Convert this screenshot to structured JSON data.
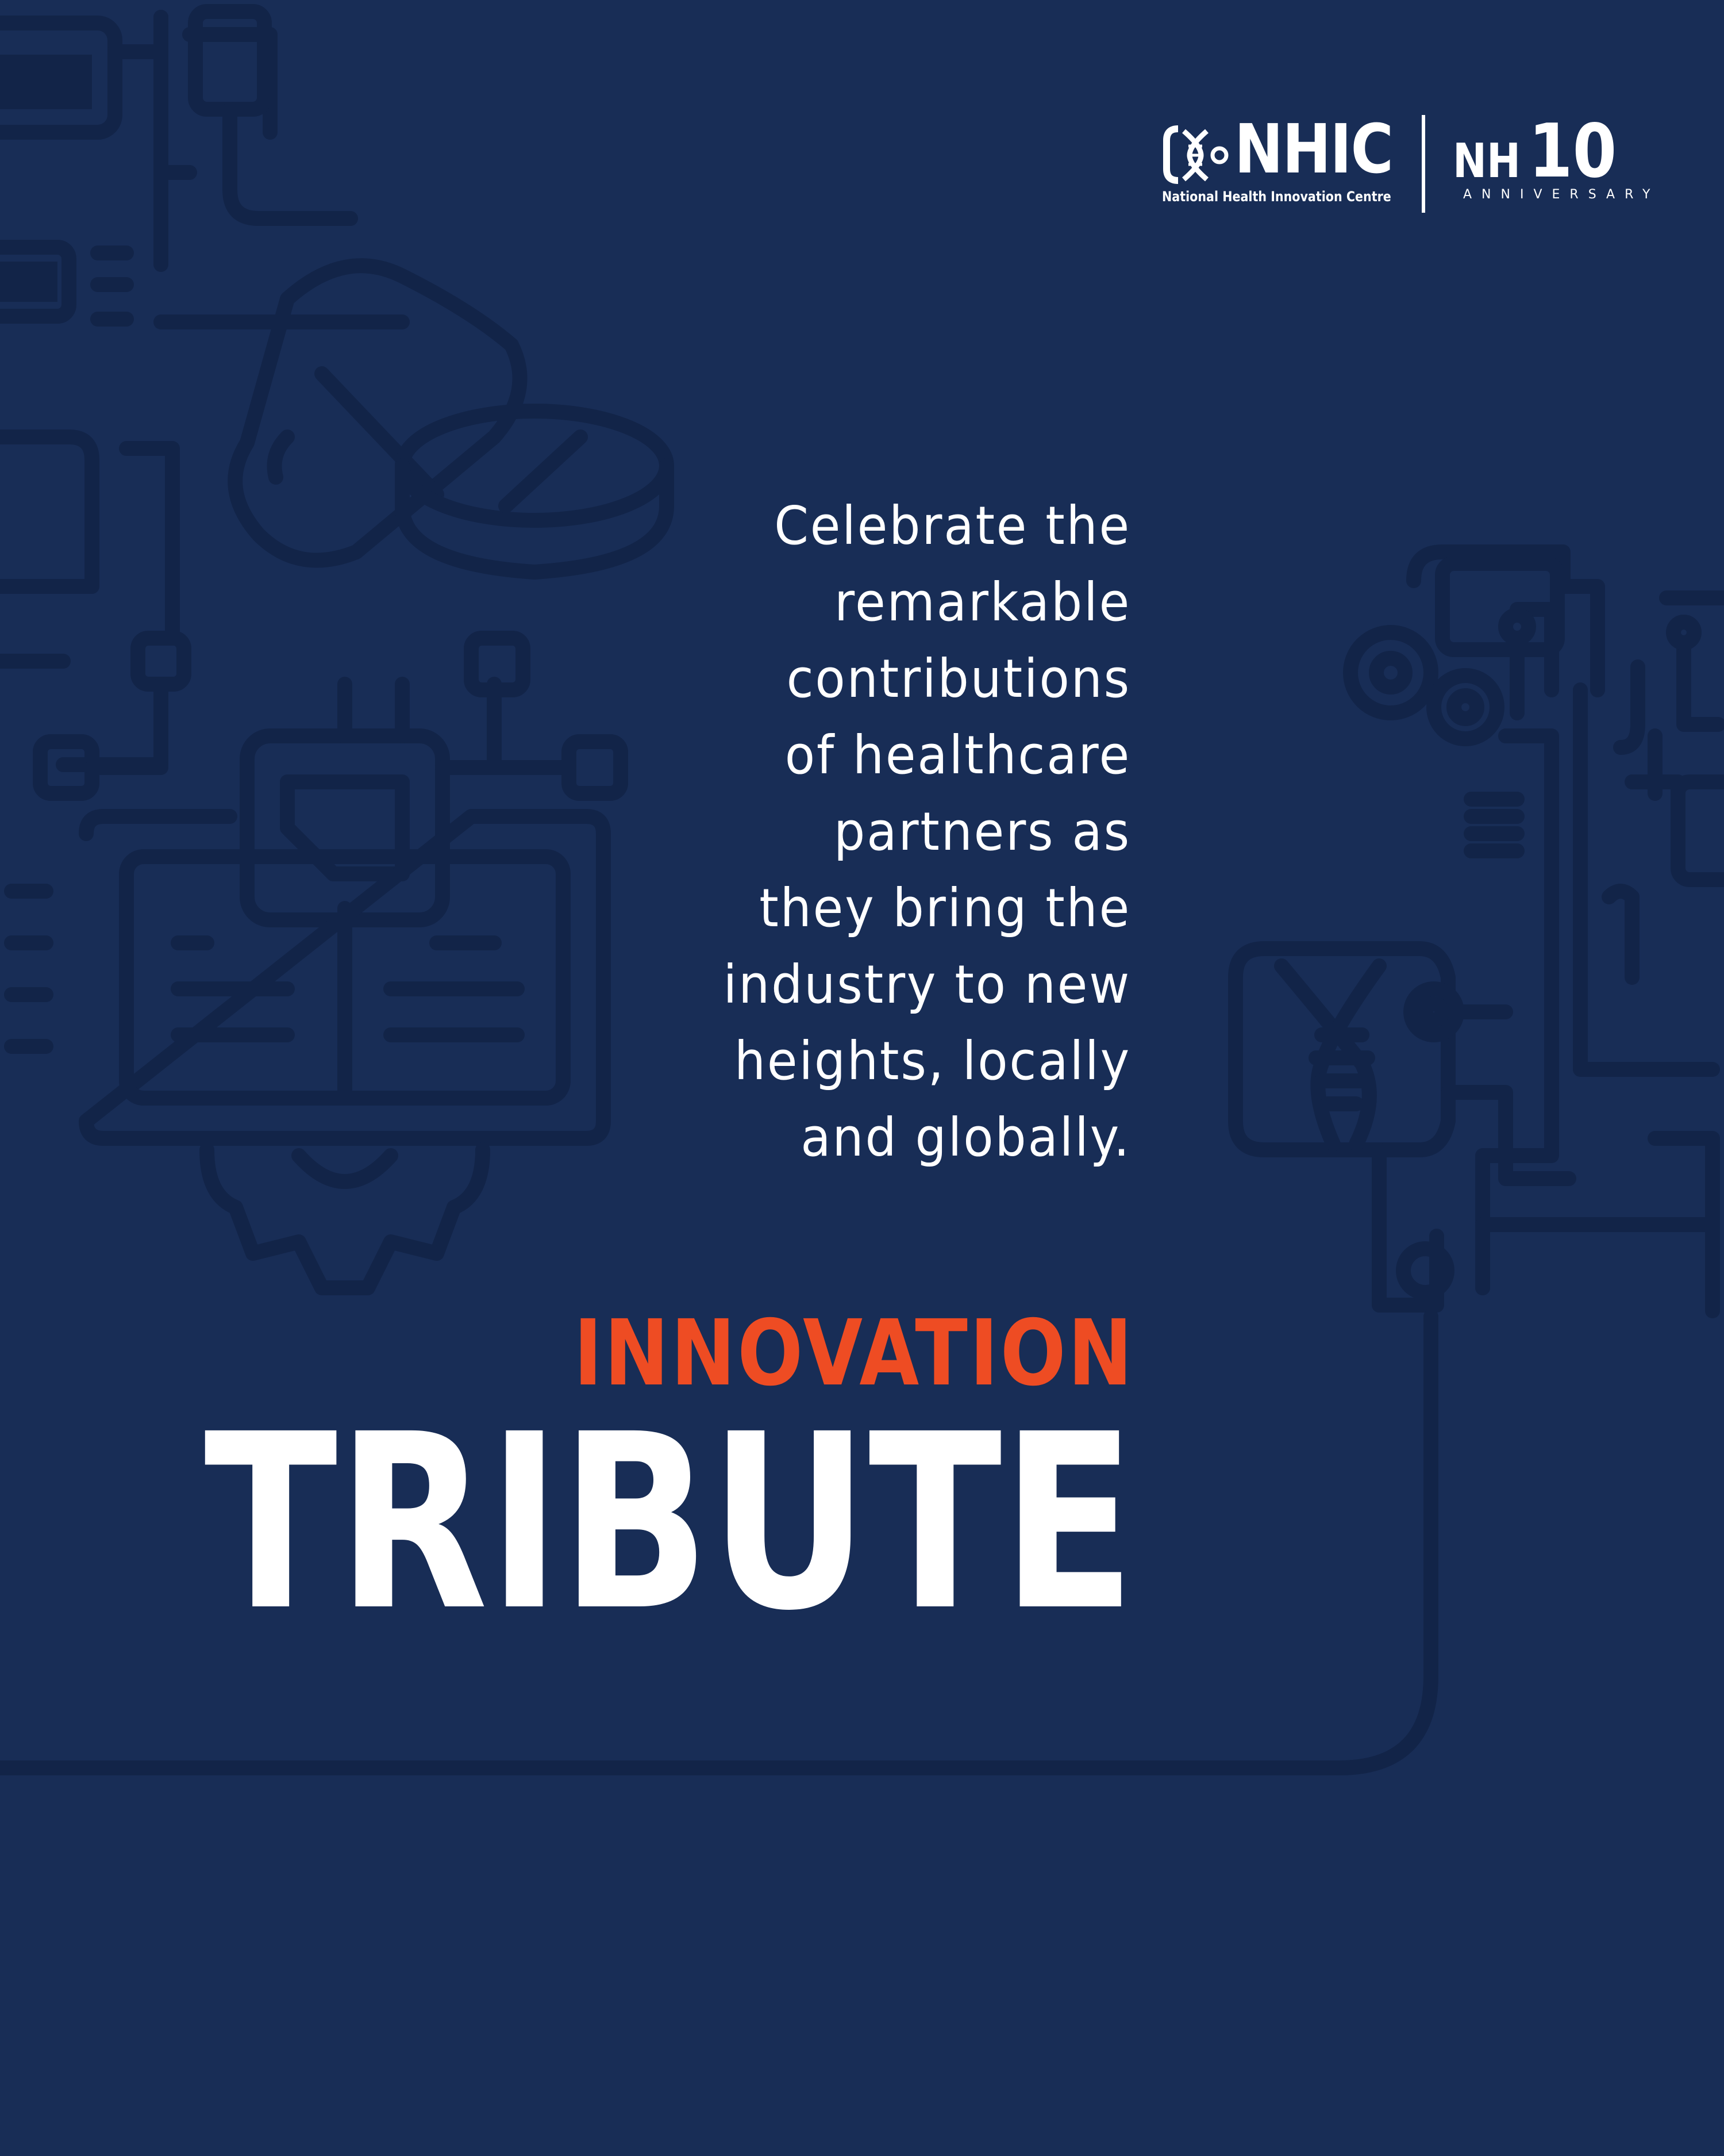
{
  "logo": {
    "name": "NHIC",
    "full_name": "National Health Innovation Centre",
    "anniversary_mark": "NH",
    "anniversary_number": "10",
    "anniversary_label": "ANNIVERSARY"
  },
  "intro": {
    "lines": [
      "Celebrate the",
      "remarkable",
      "contributions",
      "of healthcare",
      "partners as",
      "they bring the",
      "industry to new",
      "heights, locally",
      "and globally."
    ]
  },
  "kicker": "INNOVATION",
  "headline": "TRIBUTE",
  "colors": {
    "background": "#182d56",
    "line_art": "#122448",
    "accent": "#ee4c23",
    "text": "#ffffff"
  }
}
